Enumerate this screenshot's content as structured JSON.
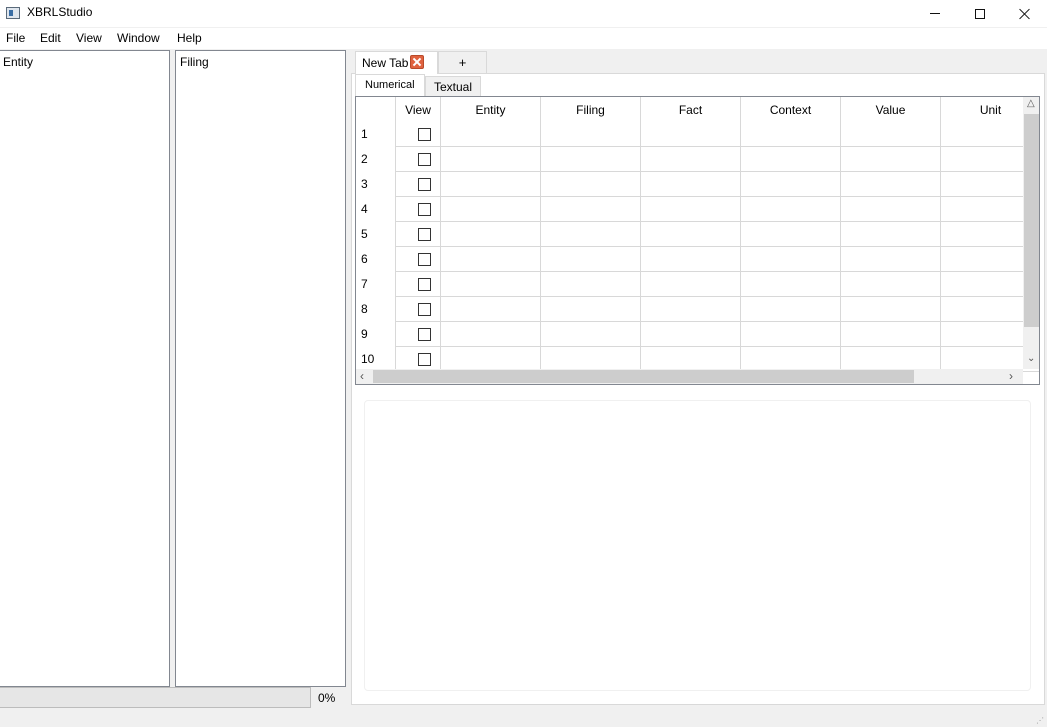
{
  "window": {
    "title": "XBRLStudio",
    "controls": {
      "minimize": "minimize",
      "maximize": "maximize",
      "close": "close"
    }
  },
  "menu": [
    "File",
    "Edit",
    "View",
    "Window",
    "Help"
  ],
  "panes": {
    "entity_label": "Entity",
    "filing_label": "Filing"
  },
  "progress": {
    "value": 0,
    "text": "0%"
  },
  "tabs": {
    "items": [
      {
        "label": "New Tab",
        "closable": true
      },
      {
        "label": "+"
      }
    ],
    "subtabs": [
      "Numerical",
      "Textual"
    ],
    "active_subtab": "Numerical"
  },
  "table": {
    "columns": [
      "View",
      "Entity",
      "Filing",
      "Fact",
      "Context",
      "Value",
      "Unit"
    ],
    "rows": [
      "1",
      "2",
      "3",
      "4",
      "5",
      "6",
      "7",
      "8",
      "9",
      "10"
    ]
  },
  "colors": {
    "accent_close": "#e0623f",
    "progress_fill": "#06b025",
    "background": "#f0f0f0"
  }
}
